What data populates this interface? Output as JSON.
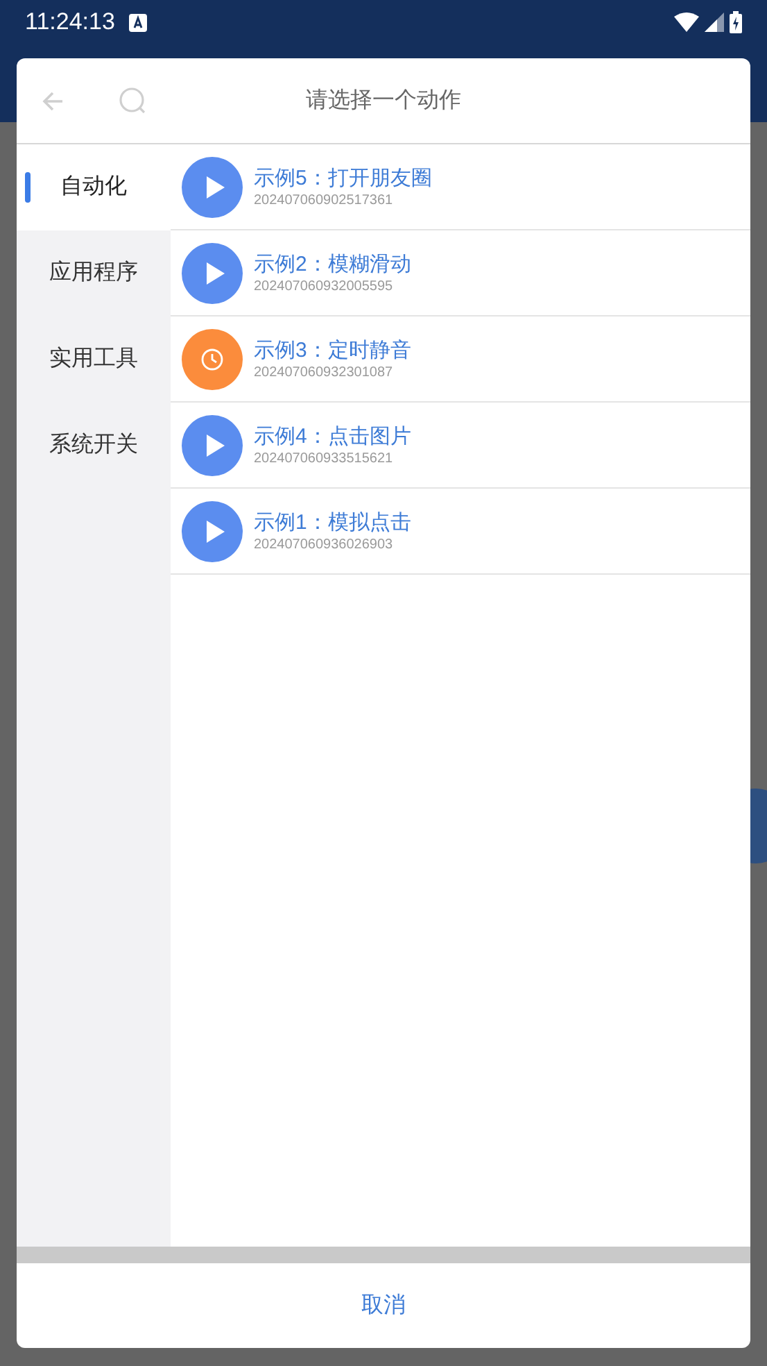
{
  "status_bar": {
    "time": "11:24:13"
  },
  "dialog": {
    "title": "请选择一个动作",
    "categories": [
      {
        "label": "自动化",
        "selected": true
      },
      {
        "label": "应用程序",
        "selected": false
      },
      {
        "label": "实用工具",
        "selected": false
      },
      {
        "label": "系统开关",
        "selected": false
      }
    ],
    "actions": [
      {
        "kind": "play",
        "color": "#5b8def",
        "title": "示例5：打开朋友圈",
        "id": "202407060902517361"
      },
      {
        "kind": "play",
        "color": "#5b8def",
        "title": "示例2：模糊滑动",
        "id": "202407060932005595"
      },
      {
        "kind": "timer",
        "color": "#fb8c3c",
        "title": "示例3：定时静音",
        "id": "202407060932301087"
      },
      {
        "kind": "play",
        "color": "#5b8def",
        "title": "示例4：点击图片",
        "id": "202407060933515621"
      },
      {
        "kind": "play",
        "color": "#5b8def",
        "title": "示例1：模拟点击",
        "id": "202407060936026903"
      }
    ],
    "cancel": "取消"
  }
}
